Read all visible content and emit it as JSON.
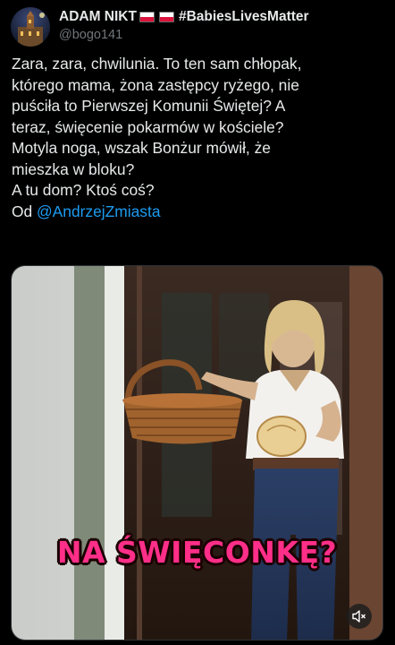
{
  "author": {
    "display_name": "ADAM NIKT",
    "hashtag": "#BabiesLivesMatter",
    "handle": "@bogo141",
    "flags": [
      "poland-flag",
      "poland-flag"
    ]
  },
  "tweet": {
    "lines": [
      "Zara, zara, chwilunia. To ten sam chłopak,",
      "którego mama, żona zastępcy ryżego, nie",
      "puściła to Pierwszej Komunii Świętej? A",
      "teraz, święcenie pokarmów w kościele?",
      "Motyla noga, wszak Bonżur mówił, że",
      "mieszka w bloku?",
      "A tu dom? Ktoś coś?"
    ],
    "credit_prefix": "Od ",
    "credit_mention": "@AndrzejZmiasta"
  },
  "video": {
    "caption": "NA ŚWIĘCONKĘ?",
    "mute_icon": "speaker-muted-icon"
  },
  "colors": {
    "background": "#000000",
    "text": "#e7e9ea",
    "secondary": "#71767b",
    "link": "#1d9bf0",
    "caption": "#ff2e88"
  }
}
